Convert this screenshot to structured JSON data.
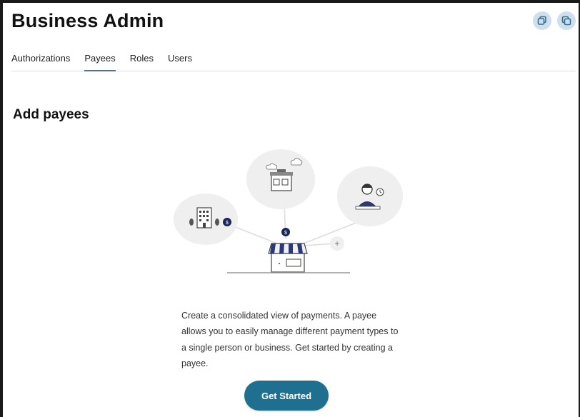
{
  "header": {
    "title": "Business Admin",
    "icons": [
      "copy-icon",
      "duplicate-icon"
    ]
  },
  "tabs": [
    {
      "label": "Authorizations",
      "active": false
    },
    {
      "label": "Payees",
      "active": true
    },
    {
      "label": "Roles",
      "active": false
    },
    {
      "label": "Users",
      "active": false
    }
  ],
  "main": {
    "title": "Add payees",
    "description": "Create a consolidated view of payments. A payee allows you to easily manage different payment types to a single person or business. Get started by creating a payee.",
    "button_label": "Get Started",
    "illustration_icons": [
      "office-building-icon",
      "shop-building-icon",
      "person-icon",
      "storefront-icon",
      "plus-icon"
    ]
  },
  "colors": {
    "accent": "#1f6f91",
    "tab_underline": "#5a6f86",
    "bubble": "#efefef",
    "icon_bg": "#cfe0ec"
  }
}
